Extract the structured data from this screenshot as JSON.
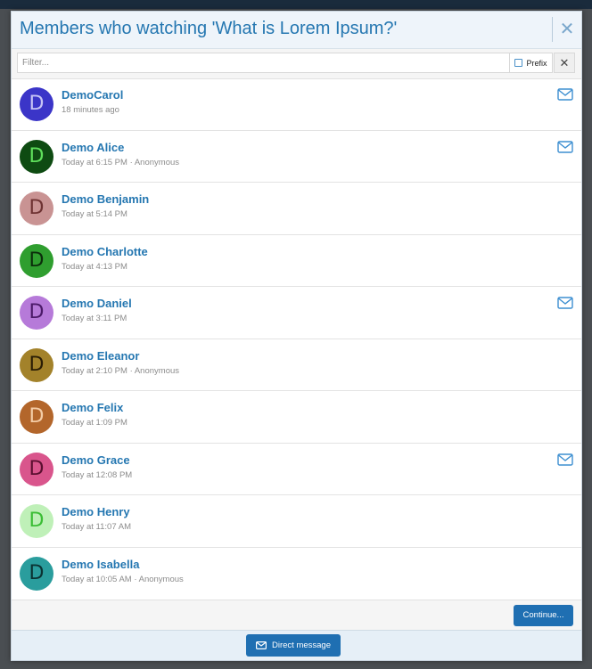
{
  "modal": {
    "title": "Members who watching 'What is Lorem Ipsum?'",
    "close_glyph": "✕"
  },
  "filter": {
    "placeholder": "Filter...",
    "value": "",
    "prefix_label": "Prefix",
    "clear_glyph": "✕"
  },
  "members": [
    {
      "initial": "D",
      "name": "DemoCarol",
      "meta": "18 minutes ago",
      "has_message_icon": true,
      "avatar_bg": "#3b35c8",
      "avatar_fg": "#c7c4f5"
    },
    {
      "initial": "D",
      "name": "Demo Alice",
      "meta": "Today at 6:15 PM · Anonymous",
      "has_message_icon": true,
      "avatar_bg": "#0e4b12",
      "avatar_fg": "#5fe05c"
    },
    {
      "initial": "D",
      "name": "Demo Benjamin",
      "meta": "Today at 5:14 PM",
      "has_message_icon": false,
      "avatar_bg": "#c99393",
      "avatar_fg": "#6e3232"
    },
    {
      "initial": "D",
      "name": "Demo Charlotte",
      "meta": "Today at 4:13 PM",
      "has_message_icon": false,
      "avatar_bg": "#2f9e2f",
      "avatar_fg": "#0b2d0b"
    },
    {
      "initial": "D",
      "name": "Demo Daniel",
      "meta": "Today at 3:11 PM",
      "has_message_icon": true,
      "avatar_bg": "#b67ad9",
      "avatar_fg": "#4b1a68"
    },
    {
      "initial": "D",
      "name": "Demo Eleanor",
      "meta": "Today at 2:10 PM · Anonymous",
      "has_message_icon": false,
      "avatar_bg": "#a3822a",
      "avatar_fg": "#2a1d05"
    },
    {
      "initial": "D",
      "name": "Demo Felix",
      "meta": "Today at 1:09 PM",
      "has_message_icon": false,
      "avatar_bg": "#b3662b",
      "avatar_fg": "#f4cda7"
    },
    {
      "initial": "D",
      "name": "Demo Grace",
      "meta": "Today at 12:08 PM",
      "has_message_icon": true,
      "avatar_bg": "#d9558c",
      "avatar_fg": "#5b0f30"
    },
    {
      "initial": "D",
      "name": "Demo Henry",
      "meta": "Today at 11:07 AM",
      "has_message_icon": false,
      "avatar_bg": "#bff0b8",
      "avatar_fg": "#3bbd35"
    },
    {
      "initial": "D",
      "name": "Demo Isabella",
      "meta": "Today at 10:05 AM · Anonymous",
      "has_message_icon": false,
      "avatar_bg": "#2a9d9d",
      "avatar_fg": "#0b3232"
    }
  ],
  "footer": {
    "continue_label": "Continue..."
  },
  "bottom_bar": {
    "direct_message_label": "Direct message",
    "icon": "envelope-icon"
  },
  "colors": {
    "link": "#2577b1",
    "button": "#1f6fb2",
    "header_bg": "#eef4fa"
  }
}
